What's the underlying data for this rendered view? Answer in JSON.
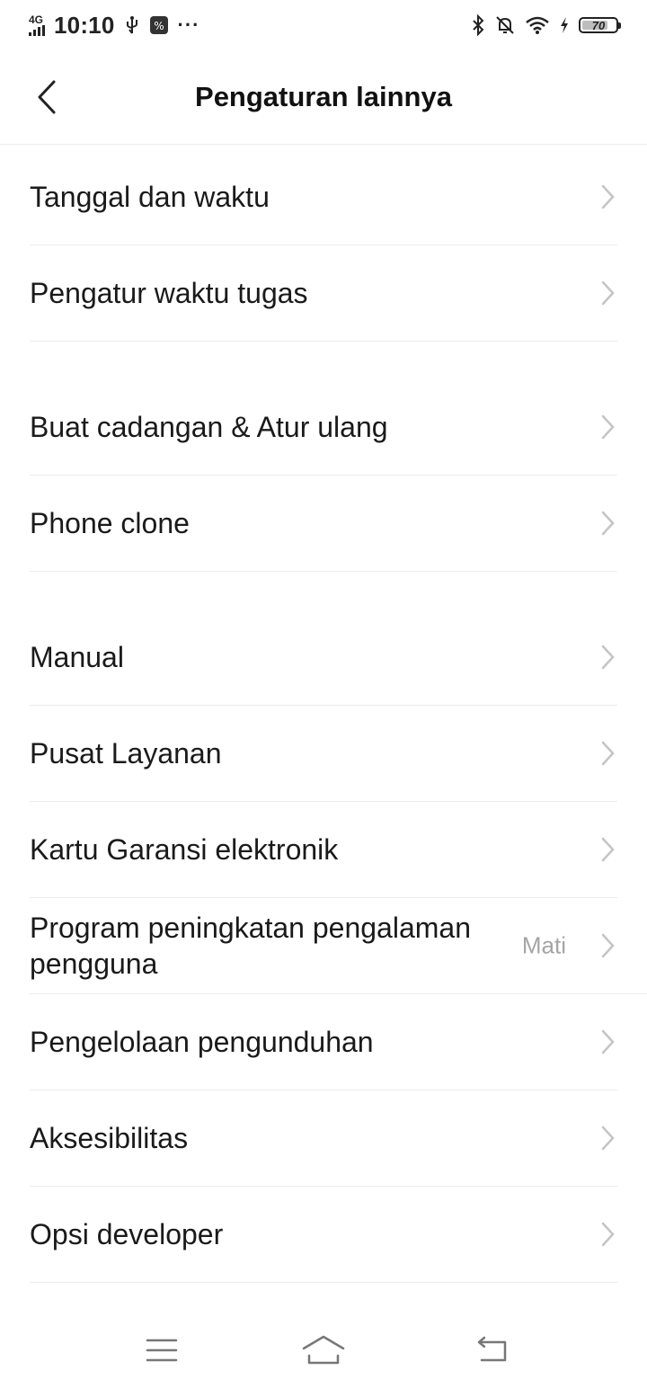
{
  "status_bar": {
    "network": "4G",
    "time": "10:10",
    "more": "···",
    "battery": "70"
  },
  "header": {
    "title": "Pengaturan lainnya"
  },
  "groups": [
    {
      "items": [
        {
          "label": "Tanggal dan waktu",
          "value": ""
        },
        {
          "label": "Pengatur waktu tugas",
          "value": ""
        }
      ]
    },
    {
      "items": [
        {
          "label": "Buat cadangan & Atur ulang",
          "value": ""
        },
        {
          "label": "Phone clone",
          "value": ""
        }
      ]
    },
    {
      "items": [
        {
          "label": "Manual",
          "value": ""
        },
        {
          "label": "Pusat Layanan",
          "value": ""
        },
        {
          "label": "Kartu Garansi elektronik",
          "value": ""
        },
        {
          "label": "Program peningkatan pengalaman pengguna",
          "value": "Mati"
        },
        {
          "label": "Pengelolaan pengunduhan",
          "value": ""
        },
        {
          "label": "Aksesibilitas",
          "value": ""
        },
        {
          "label": "Opsi developer",
          "value": ""
        }
      ]
    }
  ],
  "icons": {
    "back": "back-arrow-icon",
    "chevron": "chevron-right-icon",
    "menu": "menu-icon",
    "home": "home-icon",
    "return": "return-icon"
  },
  "colors": {
    "text": "#1a1a1a",
    "secondary": "#a5a5a5",
    "divider": "#ececec",
    "chevron": "#c4c4c4"
  }
}
